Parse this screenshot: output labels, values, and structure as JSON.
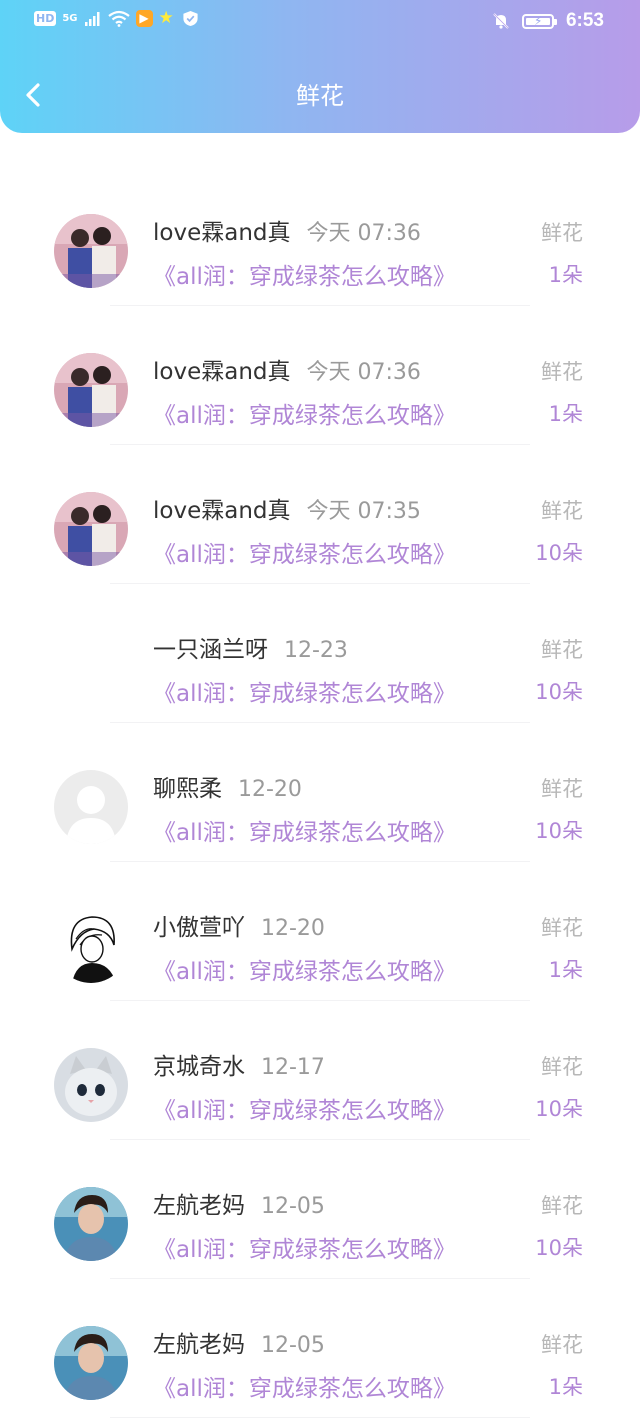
{
  "status_bar": {
    "hd": "HD",
    "network": "5G",
    "time": "6:53"
  },
  "header": {
    "title": "鲜花"
  },
  "records": [
    {
      "name": "love霖and真",
      "time": "今天 07:36",
      "book": "《all润：穿成绿茶怎么攻略》",
      "gift": "鲜花",
      "count": "1朵",
      "avatar": "couple-photo"
    },
    {
      "name": "love霖and真",
      "time": "今天 07:36",
      "book": "《all润：穿成绿茶怎么攻略》",
      "gift": "鲜花",
      "count": "1朵",
      "avatar": "couple-photo"
    },
    {
      "name": "love霖and真",
      "time": "今天 07:35",
      "book": "《all润：穿成绿茶怎么攻略》",
      "gift": "鲜花",
      "count": "10朵",
      "avatar": "couple-photo"
    },
    {
      "name": "一只涵兰呀",
      "time": "12-23",
      "book": "《all润：穿成绿茶怎么攻略》",
      "gift": "鲜花",
      "count": "10朵",
      "avatar": "none"
    },
    {
      "name": "聊熙柔",
      "time": "12-20",
      "book": "《all润：穿成绿茶怎么攻略》",
      "gift": "鲜花",
      "count": "10朵",
      "avatar": "default"
    },
    {
      "name": "小傲萱吖",
      "time": "12-20",
      "book": "《all润：穿成绿茶怎么攻略》",
      "gift": "鲜花",
      "count": "1朵",
      "avatar": "sketch"
    },
    {
      "name": "京城奇水",
      "time": "12-17",
      "book": "《all润：穿成绿茶怎么攻略》",
      "gift": "鲜花",
      "count": "10朵",
      "avatar": "cat"
    },
    {
      "name": "左航老妈",
      "time": "12-05",
      "book": "《all润：穿成绿茶怎么攻略》",
      "gift": "鲜花",
      "count": "10朵",
      "avatar": "boy-photo"
    },
    {
      "name": "左航老妈",
      "time": "12-05",
      "book": "《all润：穿成绿茶怎么攻略》",
      "gift": "鲜花",
      "count": "1朵",
      "avatar": "boy-photo"
    }
  ],
  "colors": {
    "accent": "#b086d6",
    "header_gradient_start": "#5ed3f7",
    "header_gradient_end": "#b79ce9"
  }
}
